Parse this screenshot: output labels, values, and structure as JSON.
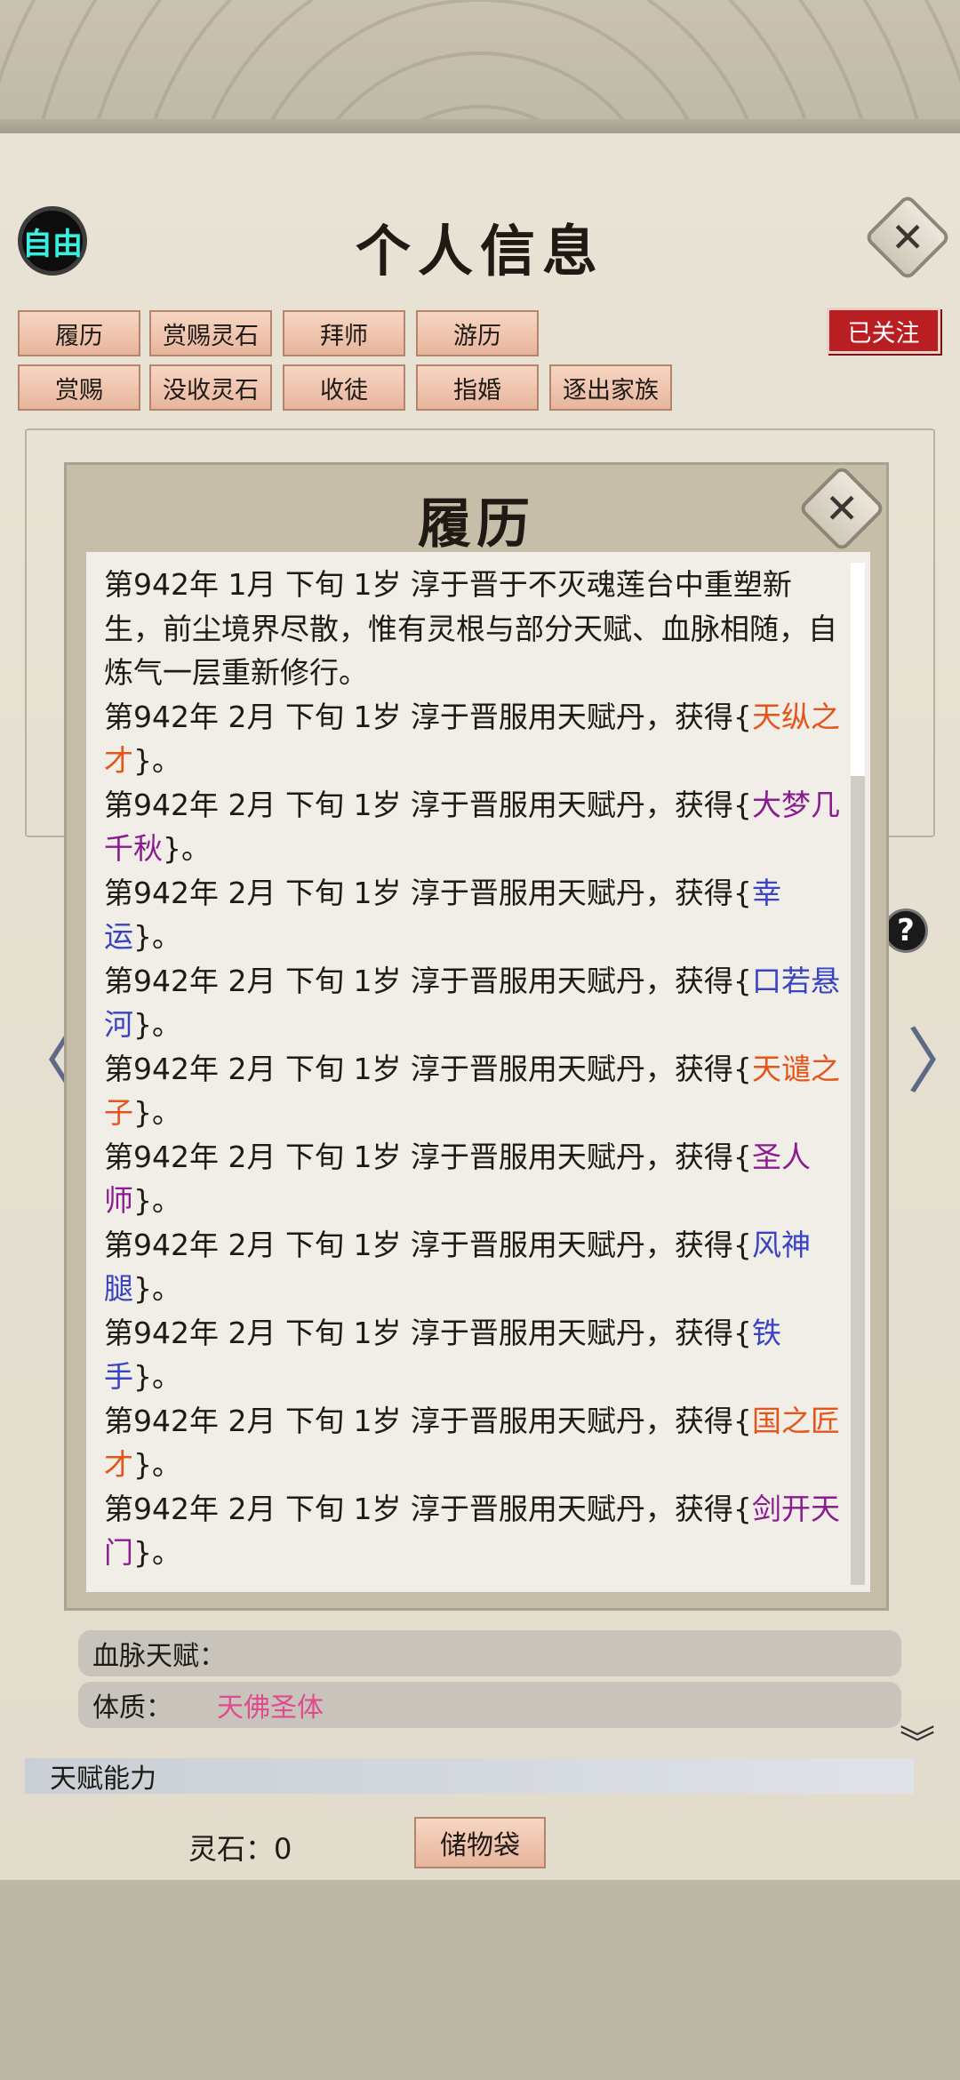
{
  "header": {
    "free_badge": "自由",
    "title": "个人信息",
    "followed_label": "已关注"
  },
  "actions": {
    "row1": [
      "履历",
      "赏赐灵石",
      "拜师",
      "游历"
    ],
    "row2": [
      "赏赐",
      "没收灵石",
      "收徒",
      "指婚",
      "逐出家族"
    ]
  },
  "dialog": {
    "title": "履历",
    "entries": [
      {
        "text": "第942年 1月 下旬  1岁  淳于晋于不灭魂莲台中重塑新生，前尘境界尽散，惟有灵根与部分天赋、血脉相随，自炼气一层重新修行。"
      },
      {
        "prefix": "第942年 2月 下旬  1岁  淳于晋服用天赋丹，获得{",
        "item": "天纵之才",
        "color": "orange",
        "suffix": "}。"
      },
      {
        "prefix": "第942年 2月 下旬  1岁  淳于晋服用天赋丹，获得{",
        "item": "大梦几千秋",
        "color": "purple",
        "suffix": "}。"
      },
      {
        "prefix": "第942年 2月 下旬  1岁  淳于晋服用天赋丹，获得{",
        "item": "幸运",
        "color": "blue",
        "suffix": "}。"
      },
      {
        "prefix": "第942年 2月 下旬  1岁  淳于晋服用天赋丹，获得{",
        "item": "口若悬河",
        "color": "blue",
        "suffix": "}。"
      },
      {
        "prefix": "第942年 2月 下旬  1岁  淳于晋服用天赋丹，获得{",
        "item": "天谴之子",
        "color": "orange",
        "suffix": "}。"
      },
      {
        "prefix": "第942年 2月 下旬  1岁  淳于晋服用天赋丹，获得{",
        "item": "圣人师",
        "color": "purple",
        "suffix": "}。"
      },
      {
        "prefix": "第942年 2月 下旬  1岁  淳于晋服用天赋丹，获得{",
        "item": "风神腿",
        "color": "blue",
        "suffix": "}。"
      },
      {
        "prefix": "第942年 2月 下旬  1岁  淳于晋服用天赋丹，获得{",
        "item": "铁手",
        "color": "blue",
        "suffix": "}。"
      },
      {
        "prefix": "第942年 2月 下旬  1岁  淳于晋服用天赋丹，获得{",
        "item": "国之匠才",
        "color": "orange",
        "suffix": "}。"
      },
      {
        "prefix": "第942年 2月 下旬  1岁  淳于晋服用天赋丹，获得{",
        "item": "剑开天门",
        "color": "purple",
        "suffix": "}。"
      }
    ]
  },
  "info": {
    "bloodline_label": "血脉天赋：",
    "physique_label": "体质：",
    "physique_value": "天佛圣体",
    "talent_section": "天赋能力"
  },
  "footer": {
    "spirit_stone_text": "灵石：0",
    "storage_label": "储物袋"
  },
  "colors": {
    "orange": "#e4551b",
    "purple": "#8a1c90",
    "blue": "#3844c4",
    "followed_red": "#b91e22",
    "physique": "#e14a8e"
  }
}
